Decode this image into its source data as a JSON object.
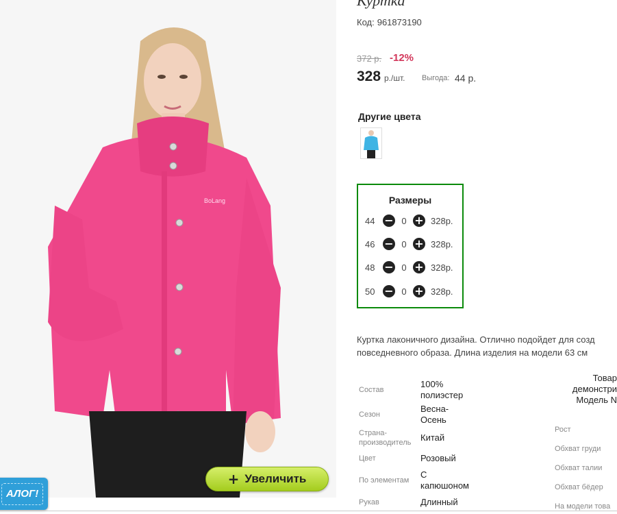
{
  "product": {
    "title": "Куртка",
    "code_label": "Код:",
    "code_value": "961873190"
  },
  "pricing": {
    "old_price": "372 р.",
    "discount": "-12%",
    "price": "328",
    "unit": "р./шт.",
    "savings_label": "Выгода:",
    "savings_value": "44 р."
  },
  "other_colors": {
    "title": "Другие цвета",
    "swatches": [
      {
        "color": "#3fb4e4",
        "icon": "blue-jacket-thumbnail"
      }
    ]
  },
  "sizes": {
    "title": "Размеры",
    "rows": [
      {
        "size": "44",
        "qty": "0",
        "price": "328р."
      },
      {
        "size": "46",
        "qty": "0",
        "price": "328р."
      },
      {
        "size": "48",
        "qty": "0",
        "price": "328р."
      },
      {
        "size": "50",
        "qty": "0",
        "price": "328р."
      }
    ],
    "border_color": "#0a8a0a"
  },
  "description": {
    "line1": "Куртка лаконичного дизайна. Отлично подойдет для созд",
    "line2": "повседневного образа. Длина изделия на модели 63 см"
  },
  "properties": [
    {
      "label": "Состав",
      "value_lines": [
        "100%",
        "полиэстер"
      ]
    },
    {
      "label": "Сезон",
      "value_lines": [
        "Весна-",
        "Осень"
      ]
    },
    {
      "label_lines": [
        "Страна-",
        "производитель"
      ],
      "value_lines": [
        "Китай"
      ]
    },
    {
      "label": "Цвет",
      "value_lines": [
        "Розовый"
      ]
    },
    {
      "label": "По элементам",
      "value_lines": [
        "С",
        "капюшоном"
      ]
    },
    {
      "label": "Рукав",
      "value_lines": [
        "Длинный"
      ]
    }
  ],
  "model_info": {
    "lines": [
      "Товар",
      "демонстри",
      "Модель N"
    ],
    "measurements": [
      "Рост",
      "Обхват груди",
      "Обхват талии",
      "Обхват бёдер",
      "На модели това"
    ]
  },
  "zoom_button": {
    "label": "Увеличить",
    "icon": "plus-icon"
  },
  "catalog_tab": {
    "label": "АЛОГ!"
  },
  "colors": {
    "jacket": "#f0498c",
    "accent_red": "#d2365a",
    "zoom_green": "#b3d93a",
    "catalog_blue": "#2f9fd9"
  }
}
